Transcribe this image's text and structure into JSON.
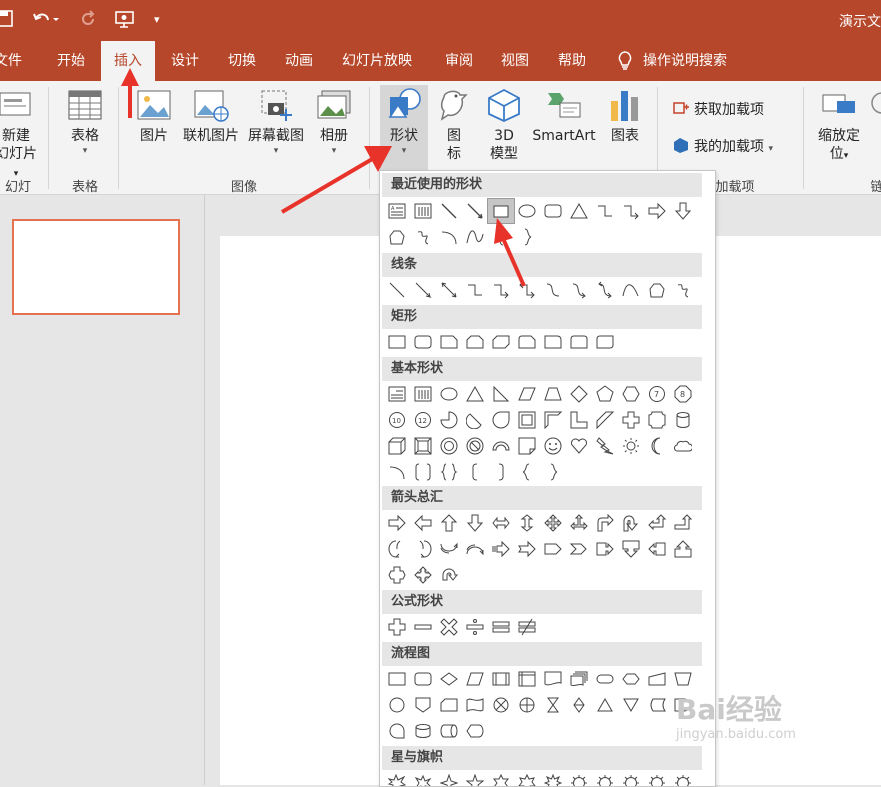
{
  "window": {
    "title": "演示文"
  },
  "quick_access": {
    "save": "save-icon",
    "undo": "undo-icon",
    "redo": "redo-icon",
    "present": "presenter-icon",
    "customize": "customize-icon"
  },
  "tabs": [
    {
      "label": "文件"
    },
    {
      "label": "开始"
    },
    {
      "label": "插入",
      "active": true
    },
    {
      "label": "设计"
    },
    {
      "label": "切换"
    },
    {
      "label": "动画"
    },
    {
      "label": "幻灯片放映"
    },
    {
      "label": "审阅"
    },
    {
      "label": "视图"
    },
    {
      "label": "帮助"
    }
  ],
  "tellme": {
    "label": "操作说明搜索",
    "icon": "lightbulb-icon"
  },
  "ribbon": {
    "new_slide": {
      "line1": "新建",
      "line2": "幻灯片"
    },
    "table": {
      "label": "表格"
    },
    "picture": {
      "label": "图片"
    },
    "online_picture": {
      "label": "联机图片"
    },
    "screenshot": {
      "label": "屏幕截图"
    },
    "album": {
      "label": "相册"
    },
    "shapes": {
      "label": "形状"
    },
    "icons": {
      "line1": "图",
      "line2": "标"
    },
    "model3d": {
      "line1": "3D",
      "line2": "模型"
    },
    "smartart": {
      "label": "SmartArt"
    },
    "chart": {
      "label": "图表"
    },
    "get_addins": {
      "label": "获取加载项"
    },
    "my_addins": {
      "label": "我的加载项"
    },
    "zoom": {
      "line1": "缩放定",
      "line2": "位"
    },
    "groups": {
      "slides": "幻灯片",
      "tables": "表格",
      "images": "图像",
      "addins": "加载项",
      "links": "链"
    }
  },
  "shapes_menu": {
    "sections": [
      {
        "title": "最近使用的形状"
      },
      {
        "title": "线条"
      },
      {
        "title": "矩形"
      },
      {
        "title": "基本形状"
      },
      {
        "title": "箭头总汇"
      },
      {
        "title": "公式形状"
      },
      {
        "title": "流程图"
      },
      {
        "title": "星与旗帜"
      }
    ]
  },
  "accent_color": "#b7472a",
  "watermark": {
    "text": "Bai经验",
    "sub": "jingyan.baidu.com"
  }
}
